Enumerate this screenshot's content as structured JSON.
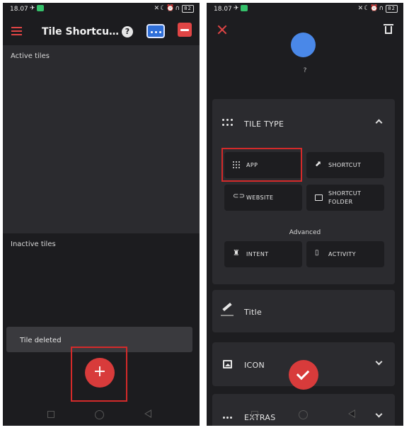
{
  "left_screen": {
    "status_bar": {
      "time": "18.07",
      "battery": "82"
    },
    "app_title": "Tile Shortcu…",
    "help_label": "?",
    "sections": {
      "active_title": "Active tiles",
      "inactive_title": "Inactive tiles"
    },
    "snackbar": "Tile deleted",
    "fab_label": "+"
  },
  "right_screen": {
    "status_bar": {
      "time": "18.07",
      "battery": "82"
    },
    "avatar_label": "?",
    "tile_type": {
      "header": "TILE TYPE",
      "buttons": {
        "app": "APP",
        "shortcut": "SHORTCUT",
        "website": "WEBSITE",
        "shortcut_folder_line1": "SHORTCUT",
        "shortcut_folder_line2": "FOLDER"
      },
      "advanced_label": "Advanced",
      "advanced_buttons": {
        "intent": "INTENT",
        "activity": "ACTIVITY"
      }
    },
    "title_row": "Title",
    "icon_row": "ICON",
    "extras_row": "EXTRAS"
  },
  "colors": {
    "accent_red": "#d83b3b",
    "highlight_red": "#d42a2a",
    "avatar_blue": "#4a88e8",
    "background_dark": "#1c1c1f",
    "surface": "#2b2b2f"
  }
}
